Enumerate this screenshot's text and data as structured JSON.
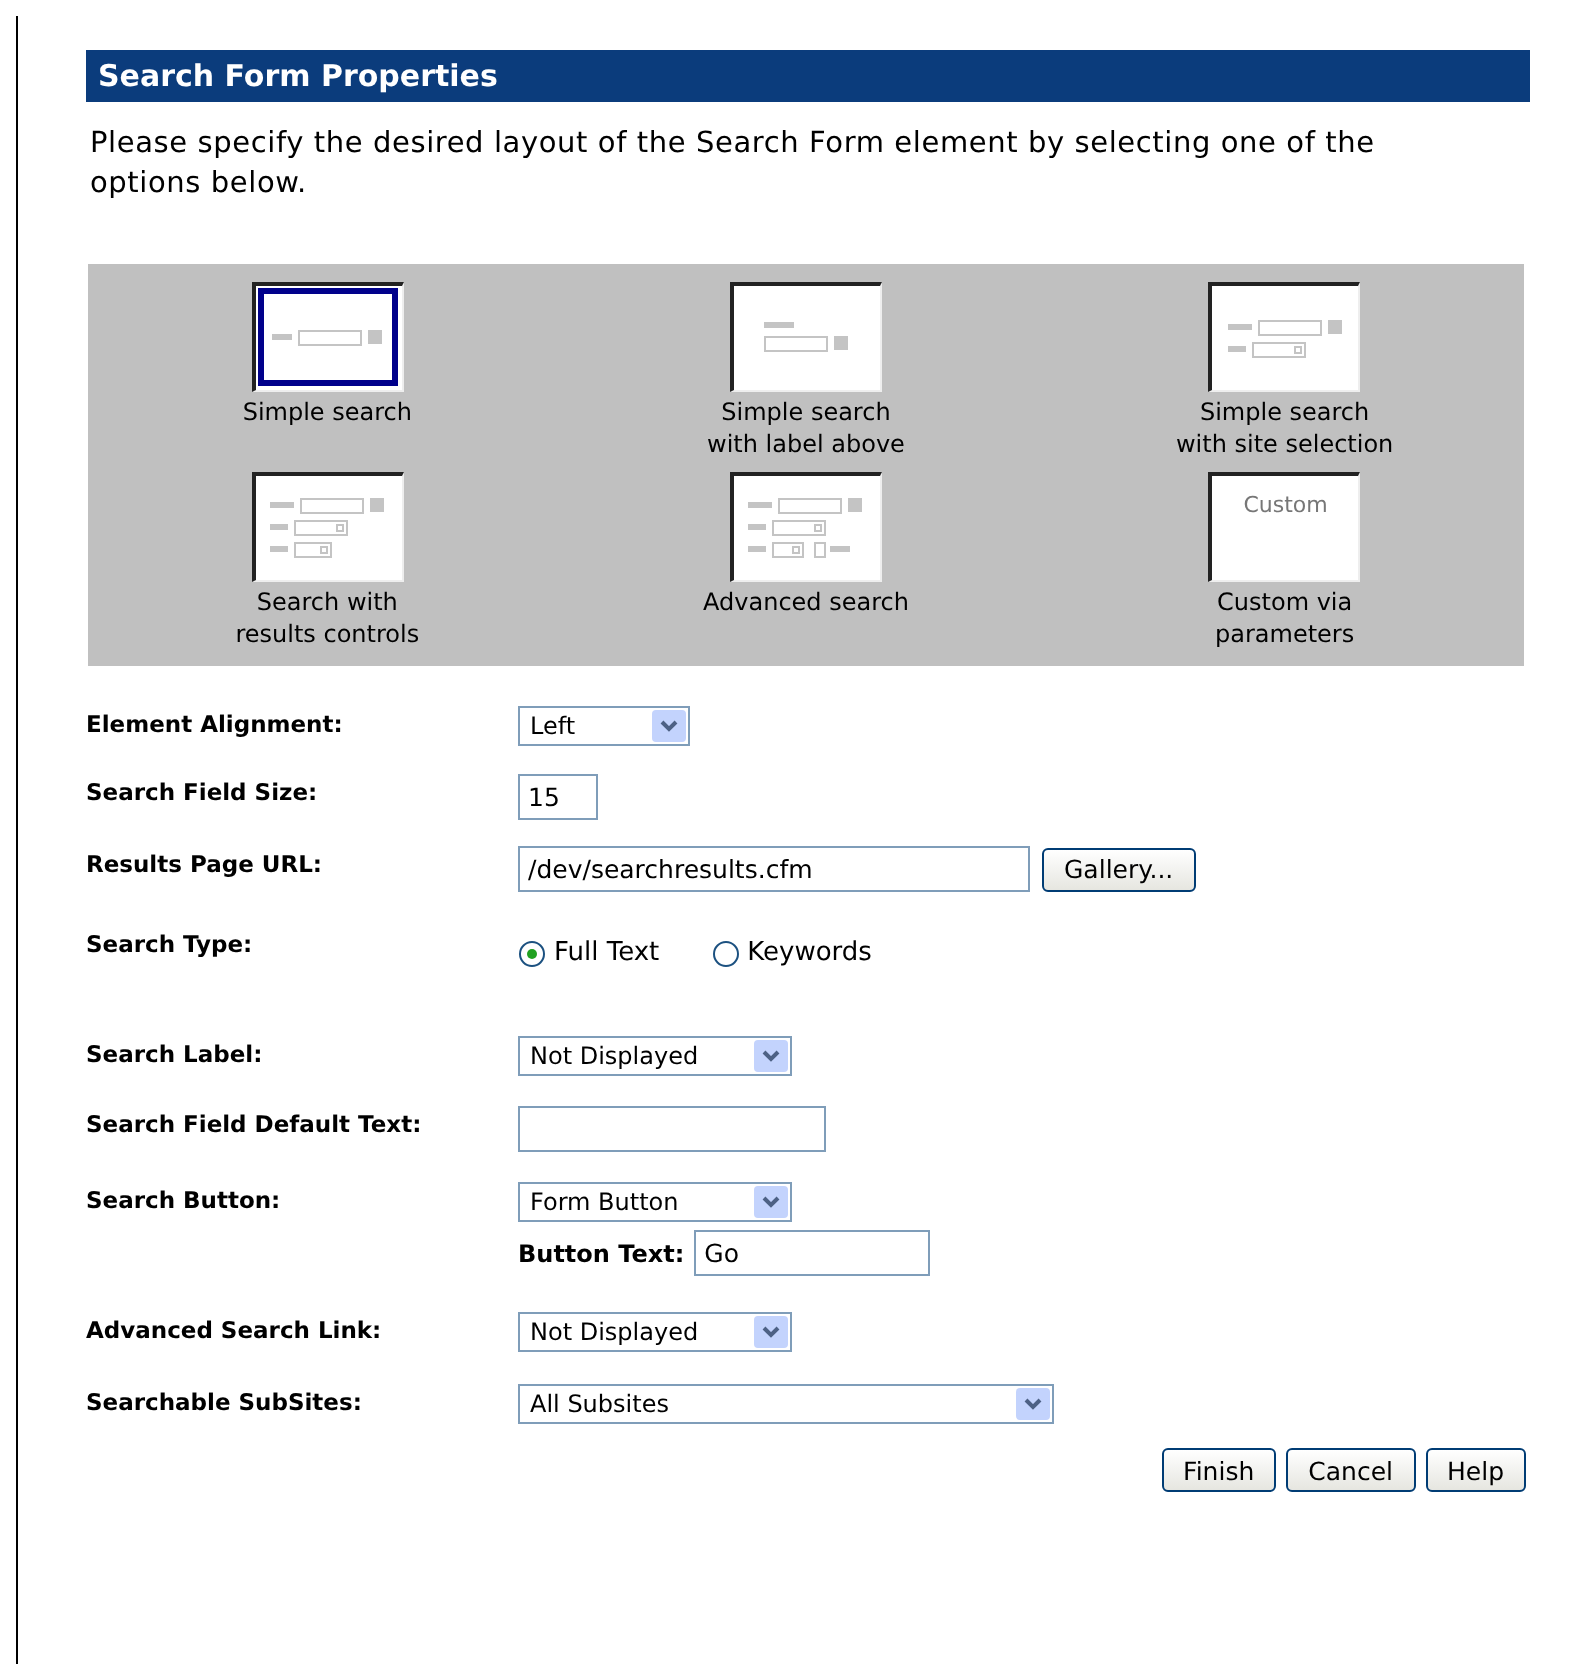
{
  "header": {
    "title": "Search Form Properties"
  },
  "intro": "Please specify the desired layout of the Search Form element by selecting one of the options below.",
  "layouts": [
    {
      "kind": "simple",
      "lines": [
        "Simple search"
      ],
      "selected": true
    },
    {
      "kind": "label_above",
      "lines": [
        "Simple search",
        "with label above"
      ],
      "selected": false
    },
    {
      "kind": "site_selection",
      "lines": [
        "Simple search",
        "with site selection"
      ],
      "selected": false
    },
    {
      "kind": "results_controls",
      "lines": [
        "Search with",
        "results controls"
      ],
      "selected": false
    },
    {
      "kind": "advanced",
      "lines": [
        "Advanced search"
      ],
      "selected": false
    },
    {
      "kind": "custom",
      "thumb_text": "Custom",
      "lines": [
        "Custom via",
        "parameters"
      ],
      "selected": false
    }
  ],
  "fields": [
    {
      "kind": "select",
      "label": "Element Alignment:",
      "value": "Left"
    },
    {
      "kind": "text",
      "label": "Search Field Size:",
      "value": "15"
    },
    {
      "kind": "text",
      "label": "Results Page URL:",
      "value": "/dev/searchresults.cfm",
      "button": "Gallery..."
    },
    {
      "kind": "radio",
      "label": "Search Type:",
      "options": [
        {
          "label": "Full Text",
          "selected": true
        },
        {
          "label": "Keywords",
          "selected": false
        }
      ]
    },
    {
      "kind": "select",
      "label": "Search Label:",
      "value": "Not Displayed"
    },
    {
      "kind": "text",
      "label": "Search Field Default Text:"
    },
    {
      "kind": "select",
      "label": "Search Button:",
      "value": "Form Button",
      "sub": {
        "label": "Button Text:",
        "value": "Go"
      }
    },
    {
      "kind": "select",
      "label": "Advanced Search Link:",
      "value": "Not Displayed"
    },
    {
      "kind": "select",
      "label": "Searchable SubSites:",
      "value": "All Subsites"
    }
  ],
  "buttons": [
    "Finish",
    "Cancel",
    "Help"
  ]
}
